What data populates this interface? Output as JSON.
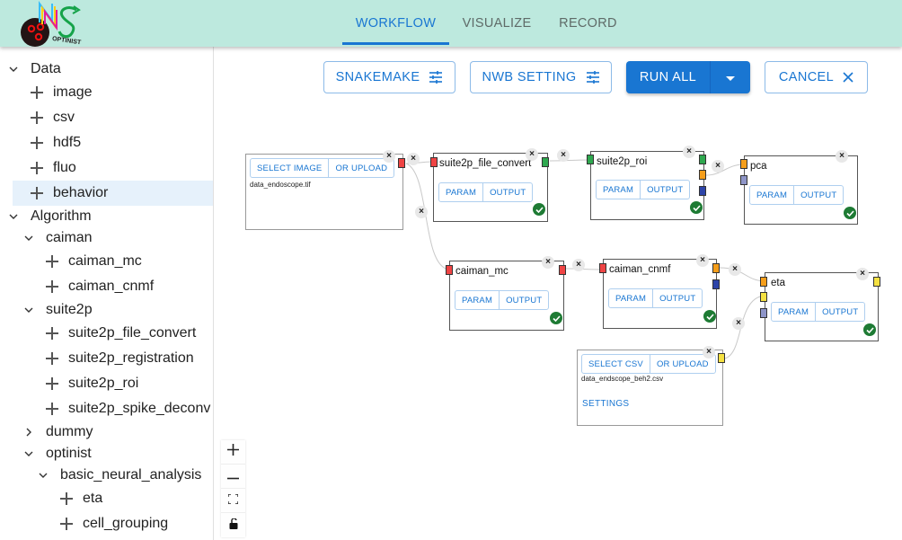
{
  "app": {
    "name": "OPTINIST",
    "logo": "optinist-logo"
  },
  "header": {
    "tabs": [
      {
        "label": "WORKFLOW",
        "active": true
      },
      {
        "label": "VISUALIZE",
        "active": false
      },
      {
        "label": "RECORD",
        "active": false
      }
    ]
  },
  "sidebar": {
    "tree": [
      {
        "label": "Data",
        "type": "folder",
        "expanded": true
      },
      {
        "label": "image",
        "type": "leaf"
      },
      {
        "label": "csv",
        "type": "leaf"
      },
      {
        "label": "hdf5",
        "type": "leaf"
      },
      {
        "label": "fluo",
        "type": "leaf"
      },
      {
        "label": "behavior",
        "type": "leaf",
        "selected": true
      },
      {
        "label": "Algorithm",
        "type": "folder",
        "expanded": true
      },
      {
        "label": "caiman",
        "type": "folder",
        "expanded": true
      },
      {
        "label": "caiman_mc",
        "type": "leaf"
      },
      {
        "label": "caiman_cnmf",
        "type": "leaf"
      },
      {
        "label": "suite2p",
        "type": "folder",
        "expanded": true
      },
      {
        "label": "suite2p_file_convert",
        "type": "leaf"
      },
      {
        "label": "suite2p_registration",
        "type": "leaf"
      },
      {
        "label": "suite2p_roi",
        "type": "leaf"
      },
      {
        "label": "suite2p_spike_deconv",
        "type": "leaf"
      },
      {
        "label": "dummy",
        "type": "folder",
        "expanded": false
      },
      {
        "label": "optinist",
        "type": "folder",
        "expanded": true
      },
      {
        "label": "basic_neural_analysis",
        "type": "folder",
        "expanded": true
      },
      {
        "label": "eta",
        "type": "leaf"
      },
      {
        "label": "cell_grouping",
        "type": "leaf"
      }
    ]
  },
  "toolbar": {
    "snakemake_label": "SNAKEMAKE",
    "nwb_label": "NWB SETTING",
    "run_all_label": "RUN ALL",
    "cancel_label": "CANCEL",
    "settings_icon": "tune-icon",
    "dropdown_icon": "arrow-drop-down-icon",
    "cancel_icon": "close-icon"
  },
  "nodes": {
    "image_input": {
      "select_label": "SELECT IMAGE",
      "upload_label": "OR UPLOAD",
      "file": "data_endoscope.tif"
    },
    "suite2p_file_convert": {
      "title": "suite2p_file_convert",
      "param": "PARAM",
      "output": "OUTPUT",
      "status": "success"
    },
    "suite2p_roi": {
      "title": "suite2p_roi",
      "param": "PARAM",
      "output": "OUTPUT",
      "status": "success"
    },
    "pca": {
      "title": "pca",
      "param": "PARAM",
      "output": "OUTPUT",
      "status": "success"
    },
    "caiman_mc": {
      "title": "caiman_mc",
      "param": "PARAM",
      "output": "OUTPUT",
      "status": "success"
    },
    "caiman_cnmf": {
      "title": "caiman_cnmf",
      "param": "PARAM",
      "output": "OUTPUT",
      "status": "success"
    },
    "eta": {
      "title": "eta",
      "param": "PARAM",
      "output": "OUTPUT",
      "status": "success"
    },
    "csv_input": {
      "select_label": "SELECT CSV",
      "upload_label": "OR UPLOAD",
      "file": "data_endscope_beh2.csv",
      "settings_label": "SETTINGS"
    }
  },
  "colors": {
    "accent": "#1976d2",
    "header_bg": "#bde9de",
    "handle_image": "#ef4444",
    "handle_suite2p": "#2fa84f",
    "handle_roi": "#f59e1b",
    "handle_iscell": "#2d44a8",
    "handle_csv": "#f5e142",
    "handle_behavior": "#8e95c8",
    "success": "#1e7b34"
  },
  "zoom_controls": [
    "zoom-in",
    "zoom-out",
    "fit-view",
    "toggle-lock"
  ]
}
